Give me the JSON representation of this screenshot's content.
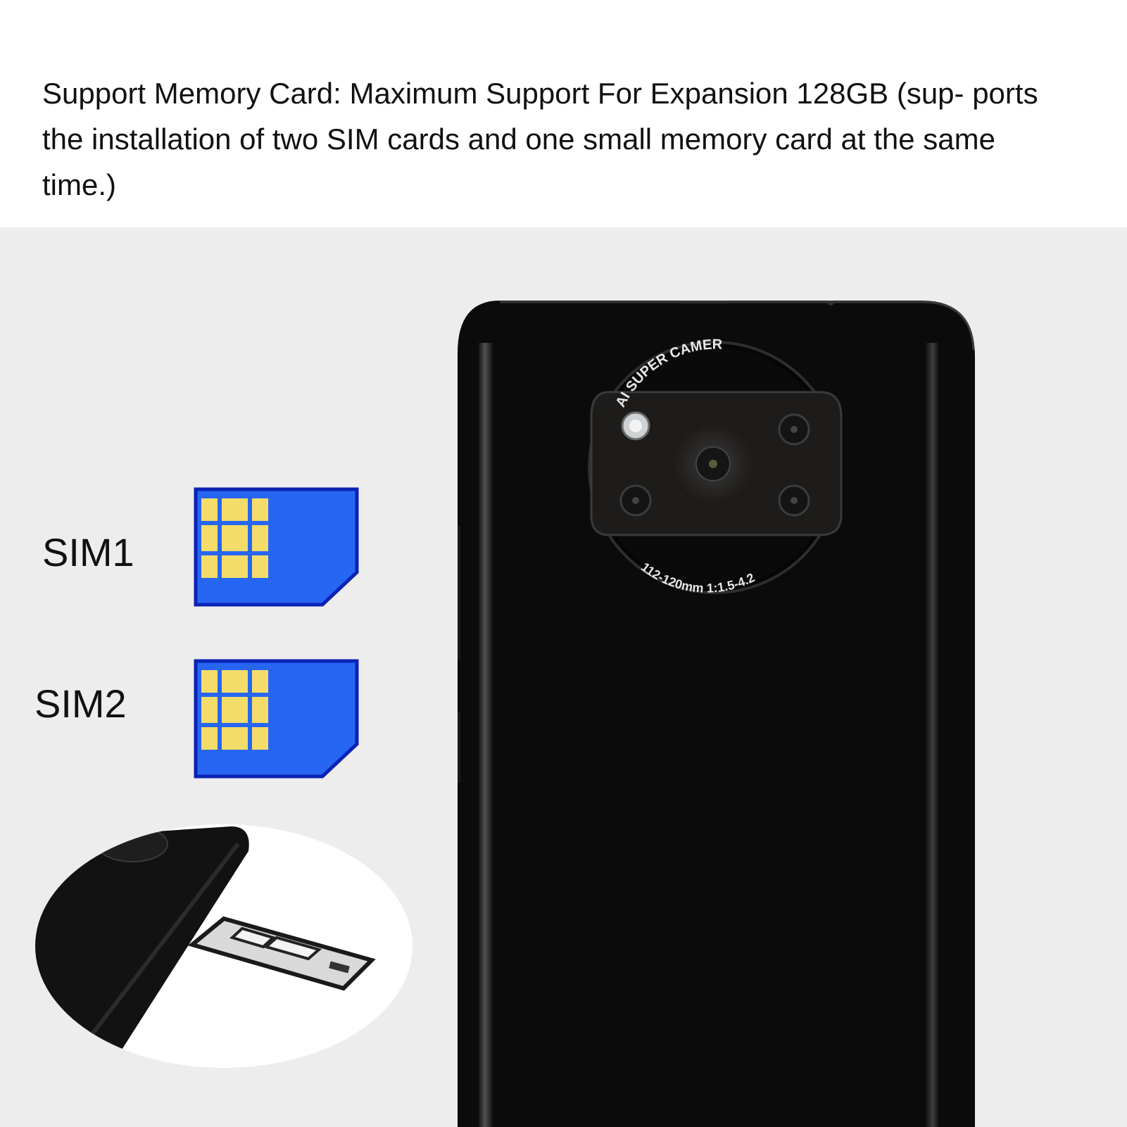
{
  "header": {
    "text": "Support Memory Card: Maximum Support For Expansion 128GB (sup- ports the installation of two SIM cards and one small memory card at the same time.)"
  },
  "sim_cards": [
    {
      "label": "SIM1"
    },
    {
      "label": "SIM2"
    }
  ],
  "camera_module": {
    "top_text": "AI SUPER CAMER",
    "bottom_text": "112-120mm 1:1.5-4.2"
  },
  "colors": {
    "sim_card_fill": "#2766f2",
    "sim_card_border": "#0a23b4",
    "sim_chip": "#f4dc6a",
    "phone_body": "#0b0b0c",
    "background": "#ededed"
  }
}
